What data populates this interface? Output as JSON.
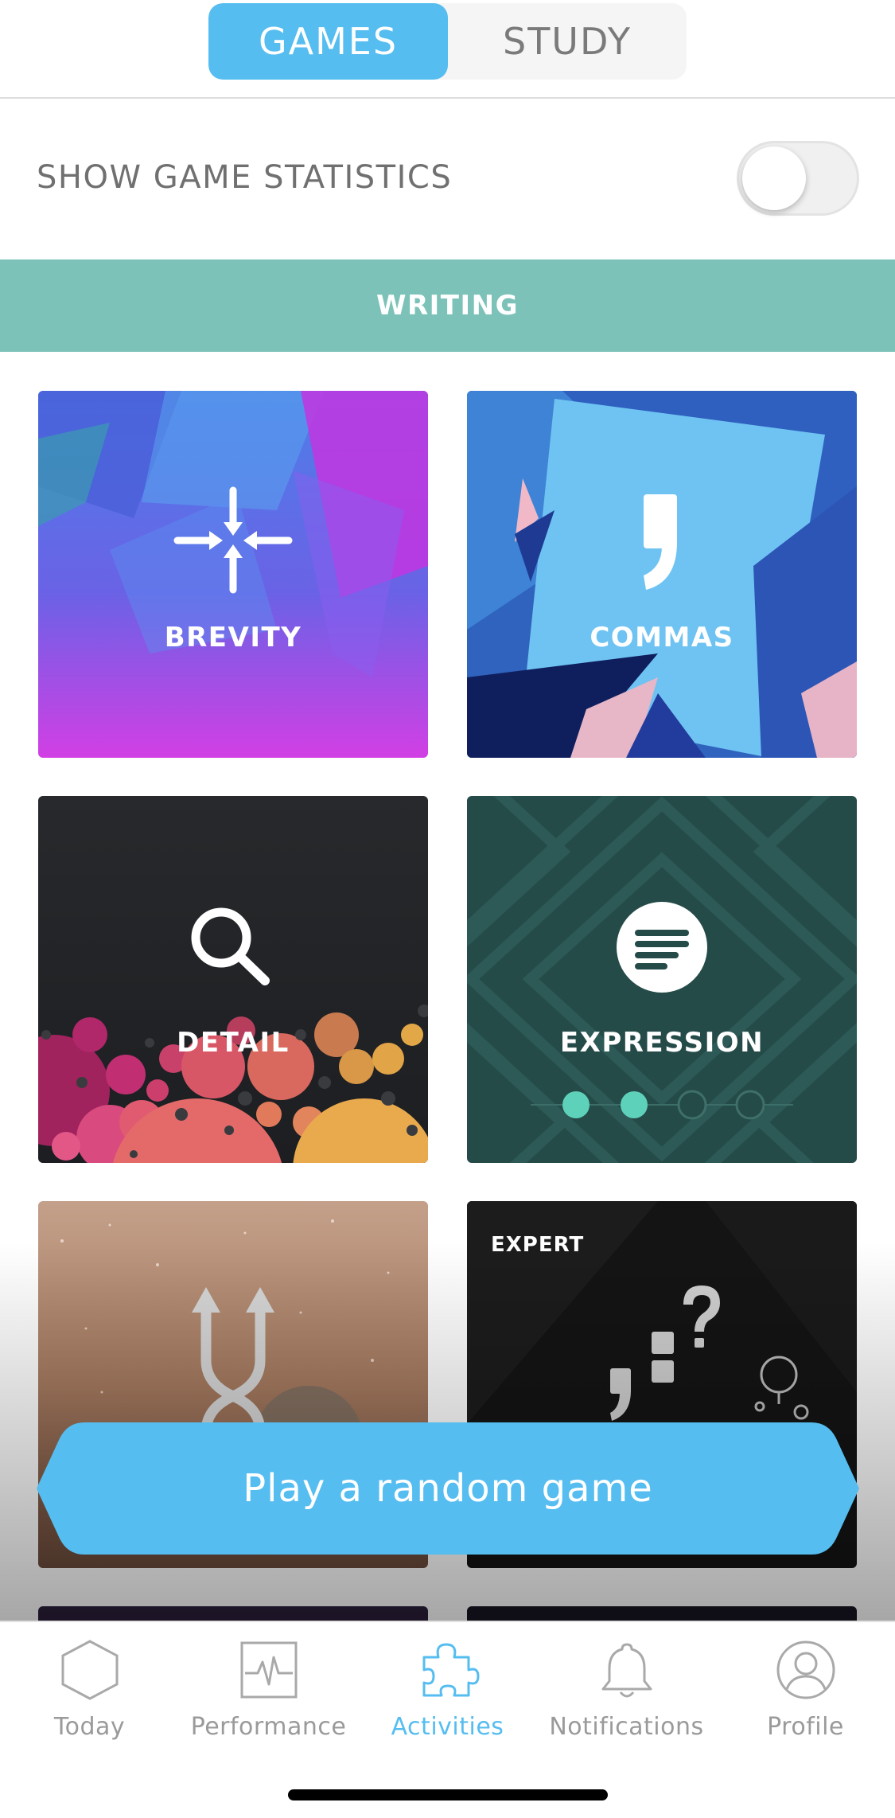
{
  "top_tabs": {
    "games_label": "GAMES",
    "study_label": "STUDY",
    "selected": "GAMES"
  },
  "statistics": {
    "label": "SHOW GAME STATISTICS",
    "toggle_on": false
  },
  "section": {
    "title": "WRITING"
  },
  "games": [
    {
      "label": "BREVITY",
      "icon": "arrows-converge-icon"
    },
    {
      "label": "COMMAS",
      "icon": "comma-icon"
    },
    {
      "label": "DETAIL",
      "icon": "magnifier-icon"
    },
    {
      "label": "EXPRESSION",
      "icon": "text-lines-icon",
      "progress_dots_filled": 2,
      "progress_dots_total": 4
    },
    {
      "label": "",
      "icon": "crossing-arrows-icon"
    },
    {
      "label": "",
      "badge": "EXPERT",
      "icon": "punctuation-question-icon"
    }
  ],
  "random_button": {
    "label": "Play a random game"
  },
  "tabbar": {
    "items": [
      {
        "label": "Today",
        "icon": "hexagon-icon"
      },
      {
        "label": "Performance",
        "icon": "pulse-chart-icon"
      },
      {
        "label": "Activities",
        "icon": "puzzle-icon",
        "active": true
      },
      {
        "label": "Notifications",
        "icon": "bell-icon"
      },
      {
        "label": "Profile",
        "icon": "person-icon"
      }
    ]
  },
  "colors": {
    "accent": "#55bdf0",
    "section_band": "#7cc2b8",
    "tab_inactive": "#9a9a9a"
  }
}
